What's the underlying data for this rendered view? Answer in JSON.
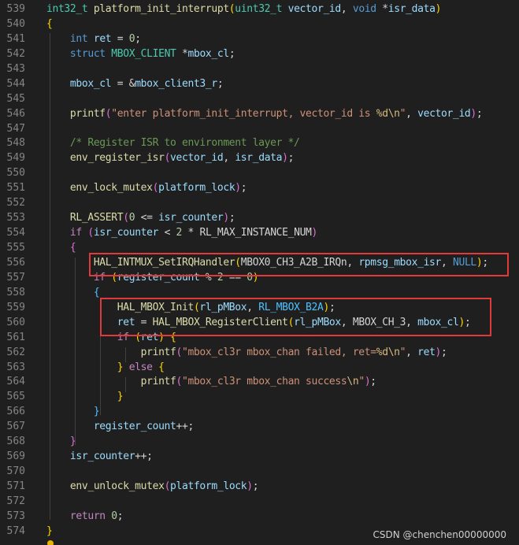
{
  "colors": {
    "background": "#1f1f1f",
    "line_number": "#858585",
    "highlight_box": "#e03a3a"
  },
  "lines": [
    {
      "n": "539",
      "tokens": [
        [
          "int32_t",
          "t-type"
        ],
        [
          " ",
          ""
        ],
        [
          "platform_init_interrupt",
          "t-fn"
        ],
        [
          "(",
          "t-brace"
        ],
        [
          "uint32_t",
          "t-type"
        ],
        [
          " ",
          ""
        ],
        [
          "vector_id",
          "t-var"
        ],
        [
          ", ",
          "t-plain"
        ],
        [
          "void",
          "t-kw"
        ],
        [
          " *",
          "t-plain"
        ],
        [
          "isr_data",
          "t-var"
        ],
        [
          ")",
          "t-brace"
        ]
      ]
    },
    {
      "n": "540",
      "tokens": [
        [
          "{",
          "t-brace"
        ]
      ]
    },
    {
      "n": "541",
      "tokens": [
        [
          "    ",
          ""
        ],
        [
          "int",
          "t-kw"
        ],
        [
          " ",
          ""
        ],
        [
          "ret",
          "t-var"
        ],
        [
          " = ",
          "t-plain"
        ],
        [
          "0",
          "t-num"
        ],
        [
          ";",
          "t-plain"
        ]
      ]
    },
    {
      "n": "542",
      "tokens": [
        [
          "    ",
          ""
        ],
        [
          "struct",
          "t-kw"
        ],
        [
          " ",
          ""
        ],
        [
          "MBOX_CLIENT",
          "t-type"
        ],
        [
          " *",
          "t-plain"
        ],
        [
          "mbox_cl",
          "t-var"
        ],
        [
          ";",
          "t-plain"
        ]
      ]
    },
    {
      "n": "543",
      "tokens": []
    },
    {
      "n": "544",
      "tokens": [
        [
          "    ",
          ""
        ],
        [
          "mbox_cl",
          "t-var"
        ],
        [
          " = &",
          "t-plain"
        ],
        [
          "mbox_client3_r",
          "t-var"
        ],
        [
          ";",
          "t-plain"
        ]
      ]
    },
    {
      "n": "545",
      "tokens": []
    },
    {
      "n": "546",
      "tokens": [
        [
          "    ",
          ""
        ],
        [
          "printf",
          "t-fn"
        ],
        [
          "(",
          "t-paren"
        ],
        [
          "\"enter platform_init_interrupt, vector_id is ",
          "t-str"
        ],
        [
          "%d\\n",
          "t-esc"
        ],
        [
          "\"",
          "t-str"
        ],
        [
          ", ",
          "t-plain"
        ],
        [
          "vector_id",
          "t-var"
        ],
        [
          ")",
          "t-paren"
        ],
        [
          ";",
          "t-plain"
        ]
      ]
    },
    {
      "n": "547",
      "tokens": []
    },
    {
      "n": "548",
      "tokens": [
        [
          "    ",
          ""
        ],
        [
          "/* Register ISR to environment layer */",
          "t-cmt"
        ]
      ]
    },
    {
      "n": "549",
      "tokens": [
        [
          "    ",
          ""
        ],
        [
          "env_register_isr",
          "t-fn"
        ],
        [
          "(",
          "t-paren"
        ],
        [
          "vector_id",
          "t-var"
        ],
        [
          ", ",
          "t-plain"
        ],
        [
          "isr_data",
          "t-var"
        ],
        [
          ")",
          "t-paren"
        ],
        [
          ";",
          "t-plain"
        ]
      ]
    },
    {
      "n": "550",
      "tokens": []
    },
    {
      "n": "551",
      "tokens": [
        [
          "    ",
          ""
        ],
        [
          "env_lock_mutex",
          "t-fn"
        ],
        [
          "(",
          "t-paren"
        ],
        [
          "platform_lock",
          "t-var"
        ],
        [
          ")",
          "t-paren"
        ],
        [
          ";",
          "t-plain"
        ]
      ]
    },
    {
      "n": "552",
      "tokens": []
    },
    {
      "n": "553",
      "tokens": [
        [
          "    ",
          ""
        ],
        [
          "RL_ASSERT",
          "t-fn"
        ],
        [
          "(",
          "t-paren"
        ],
        [
          "0",
          "t-num"
        ],
        [
          " <= ",
          "t-plain"
        ],
        [
          "isr_counter",
          "t-var"
        ],
        [
          ")",
          "t-paren"
        ],
        [
          ";",
          "t-plain"
        ]
      ]
    },
    {
      "n": "554",
      "tokens": [
        [
          "    ",
          ""
        ],
        [
          "if",
          "t-ctl"
        ],
        [
          " ",
          ""
        ],
        [
          "(",
          "t-paren"
        ],
        [
          "isr_counter",
          "t-var"
        ],
        [
          " < ",
          "t-plain"
        ],
        [
          "2",
          "t-num"
        ],
        [
          " * ",
          "t-plain"
        ],
        [
          "RL_MAX_INSTANCE_NUM",
          "t-plain"
        ],
        [
          ")",
          "t-paren"
        ]
      ]
    },
    {
      "n": "555",
      "tokens": [
        [
          "    ",
          ""
        ],
        [
          "{",
          "t-paren"
        ]
      ]
    },
    {
      "n": "556",
      "tokens": [
        [
          "        ",
          ""
        ],
        [
          "HAL_INTMUX_SetIRQHandler",
          "t-fn"
        ],
        [
          "(",
          "t-brace"
        ],
        [
          "MBOX0_CH3_A2B_IRQn",
          "t-plain"
        ],
        [
          ", ",
          "t-plain"
        ],
        [
          "rpmsg_mbox_isr",
          "t-var"
        ],
        [
          ", ",
          "t-plain"
        ],
        [
          "NULL",
          "t-kw"
        ],
        [
          ")",
          "t-brace"
        ],
        [
          ";",
          "t-plain"
        ]
      ]
    },
    {
      "n": "557",
      "tokens": [
        [
          "        ",
          ""
        ],
        [
          "if",
          "t-ctl"
        ],
        [
          " ",
          ""
        ],
        [
          "(",
          "t-brace"
        ],
        [
          "register_count",
          "t-var"
        ],
        [
          " % ",
          "t-plain"
        ],
        [
          "2",
          "t-num"
        ],
        [
          " == ",
          "t-plain"
        ],
        [
          "0",
          "t-num"
        ],
        [
          ")",
          "t-brace"
        ]
      ]
    },
    {
      "n": "558",
      "tokens": [
        [
          "        ",
          ""
        ],
        [
          "{",
          "t-mac"
        ]
      ]
    },
    {
      "n": "559",
      "tokens": [
        [
          "            ",
          ""
        ],
        [
          "HAL_MBOX_Init",
          "t-fn"
        ],
        [
          "(",
          "t-brace"
        ],
        [
          "rl_pMBox",
          "t-var"
        ],
        [
          ", ",
          "t-plain"
        ],
        [
          "RL_MBOX_B2A",
          "t-mac"
        ],
        [
          ")",
          "t-brace"
        ],
        [
          ";",
          "t-plain"
        ]
      ]
    },
    {
      "n": "560",
      "tokens": [
        [
          "            ",
          ""
        ],
        [
          "ret",
          "t-var"
        ],
        [
          " = ",
          "t-plain"
        ],
        [
          "HAL_MBOX_RegisterClient",
          "t-fn"
        ],
        [
          "(",
          "t-brace"
        ],
        [
          "rl_pMBox",
          "t-var"
        ],
        [
          ", ",
          "t-plain"
        ],
        [
          "MBOX_CH_3",
          "t-plain"
        ],
        [
          ", ",
          "t-plain"
        ],
        [
          "mbox_cl",
          "t-var"
        ],
        [
          ")",
          "t-brace"
        ],
        [
          ";",
          "t-plain"
        ]
      ]
    },
    {
      "n": "561",
      "tokens": [
        [
          "            ",
          ""
        ],
        [
          "if",
          "t-ctl"
        ],
        [
          " ",
          ""
        ],
        [
          "(",
          "t-brace"
        ],
        [
          "ret",
          "t-var"
        ],
        [
          ")",
          "t-brace"
        ],
        [
          " ",
          ""
        ],
        [
          "{",
          "t-brace"
        ]
      ]
    },
    {
      "n": "562",
      "tokens": [
        [
          "                ",
          ""
        ],
        [
          "printf",
          "t-fn"
        ],
        [
          "(",
          "t-paren"
        ],
        [
          "\"mbox_cl3r mbox_chan failed, ret=",
          "t-str"
        ],
        [
          "%d\\n",
          "t-esc"
        ],
        [
          "\"",
          "t-str"
        ],
        [
          ", ",
          "t-plain"
        ],
        [
          "ret",
          "t-var"
        ],
        [
          ")",
          "t-paren"
        ],
        [
          ";",
          "t-plain"
        ]
      ]
    },
    {
      "n": "563",
      "tokens": [
        [
          "            ",
          ""
        ],
        [
          "}",
          "t-brace"
        ],
        [
          " ",
          ""
        ],
        [
          "else",
          "t-ctl"
        ],
        [
          " ",
          ""
        ],
        [
          "{",
          "t-brace"
        ]
      ]
    },
    {
      "n": "564",
      "tokens": [
        [
          "                ",
          ""
        ],
        [
          "printf",
          "t-fn"
        ],
        [
          "(",
          "t-paren"
        ],
        [
          "\"mbox_cl3r mbox_chan success",
          "t-str"
        ],
        [
          "\\n",
          "t-esc"
        ],
        [
          "\"",
          "t-str"
        ],
        [
          ")",
          "t-paren"
        ],
        [
          ";",
          "t-plain"
        ]
      ]
    },
    {
      "n": "565",
      "tokens": [
        [
          "            ",
          ""
        ],
        [
          "}",
          "t-brace"
        ]
      ]
    },
    {
      "n": "566",
      "tokens": [
        [
          "        ",
          ""
        ],
        [
          "}",
          "t-mac"
        ]
      ]
    },
    {
      "n": "567",
      "tokens": [
        [
          "        ",
          ""
        ],
        [
          "register_count",
          "t-var"
        ],
        [
          "++;",
          "t-plain"
        ]
      ]
    },
    {
      "n": "568",
      "tokens": [
        [
          "    ",
          ""
        ],
        [
          "}",
          "t-paren"
        ]
      ]
    },
    {
      "n": "569",
      "tokens": [
        [
          "    ",
          ""
        ],
        [
          "isr_counter",
          "t-var"
        ],
        [
          "++;",
          "t-plain"
        ]
      ]
    },
    {
      "n": "570",
      "tokens": []
    },
    {
      "n": "571",
      "tokens": [
        [
          "    ",
          ""
        ],
        [
          "env_unlock_mutex",
          "t-fn"
        ],
        [
          "(",
          "t-paren"
        ],
        [
          "platform_lock",
          "t-var"
        ],
        [
          ")",
          "t-paren"
        ],
        [
          ";",
          "t-plain"
        ]
      ]
    },
    {
      "n": "572",
      "tokens": []
    },
    {
      "n": "573",
      "tokens": [
        [
          "    ",
          ""
        ],
        [
          "return",
          "t-ctl"
        ],
        [
          " ",
          ""
        ],
        [
          "0",
          "t-num"
        ],
        [
          ";",
          "t-plain"
        ]
      ]
    },
    {
      "n": "574",
      "tokens": [
        [
          "}",
          "t-brace"
        ]
      ]
    }
  ],
  "watermark": "CSDN @chenchen00000000",
  "icons": {
    "lightbulb": "lightbulb-icon"
  }
}
